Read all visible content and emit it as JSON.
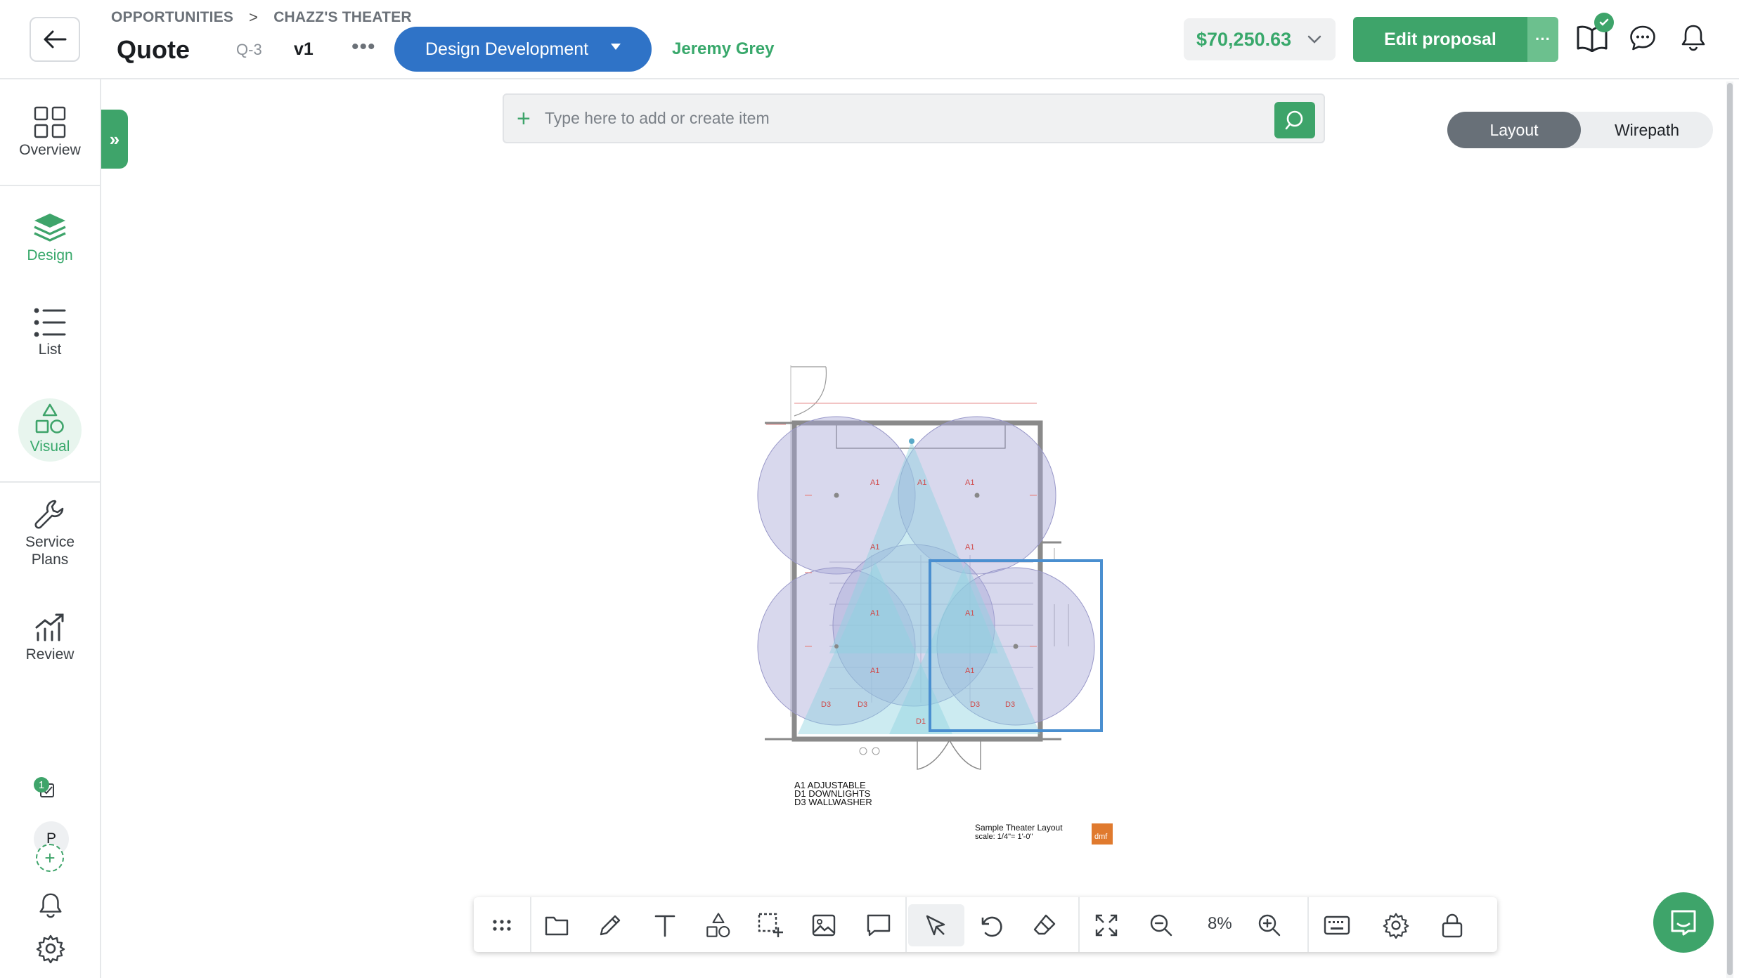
{
  "header": {
    "breadcrumb": [
      "OPPORTUNITIES",
      "CHAZZ'S THEATER"
    ],
    "breadcrumb_sep": ">",
    "title": "Quote",
    "quote_id": "Q-3",
    "version": "v1",
    "more": "•••",
    "stage": "Design Development",
    "owner": "Jeremy Grey",
    "price": "$70,250.63",
    "edit_label": "Edit proposal",
    "edit_more": "···"
  },
  "sidebar": {
    "items": [
      {
        "label": "Overview",
        "icon": "grid-icon"
      },
      {
        "label": "Design",
        "icon": "layers-icon"
      },
      {
        "label": "List",
        "icon": "list-icon"
      },
      {
        "label": "Visual",
        "icon": "shapes-icon"
      },
      {
        "label": "Service Plans",
        "icon": "wrench-icon"
      },
      {
        "label": "Review",
        "icon": "chart-icon"
      }
    ],
    "active": "Visual",
    "expand": "»",
    "task_count": "1",
    "avatar_initial": "P",
    "avatar_add": "+"
  },
  "search": {
    "plus": "+",
    "placeholder": "Type here to add or create item"
  },
  "view_toggle": {
    "layout": "Layout",
    "wirepath": "Wirepath",
    "selected": "Layout"
  },
  "drawing": {
    "legend": [
      "A1 ADJUSTABLE",
      "D1 DOWNLIGHTS",
      "D3 WALLWASHER"
    ],
    "caption": "Sample Theater Layout",
    "scale": "scale: 1/4\"= 1'-0\"",
    "logo": "dmf",
    "fixture_labels": [
      "A1",
      "A1",
      "A1",
      "A1",
      "A1",
      "A1",
      "A1",
      "A1",
      "A1",
      "D3",
      "D3",
      "D3",
      "D3",
      "D1"
    ]
  },
  "toolbar": {
    "zoom": "8%",
    "tools": [
      "drag-handle-icon",
      "folder-icon",
      "pencil-icon",
      "text-icon",
      "shapes-icon",
      "marquee-icon",
      "image-icon",
      "comment-icon",
      "cursor-icon",
      "undo-icon",
      "eraser-icon",
      "fit-icon",
      "zoom-out-icon",
      "zoom-in-icon",
      "keyboard-icon",
      "gear-icon",
      "lock-icon"
    ]
  },
  "colors": {
    "brand_green": "#3ea46a",
    "stage_blue": "#2f73c7",
    "coverage_circle": "#a9a8d8",
    "beam_cyan": "#8fd3e0"
  }
}
